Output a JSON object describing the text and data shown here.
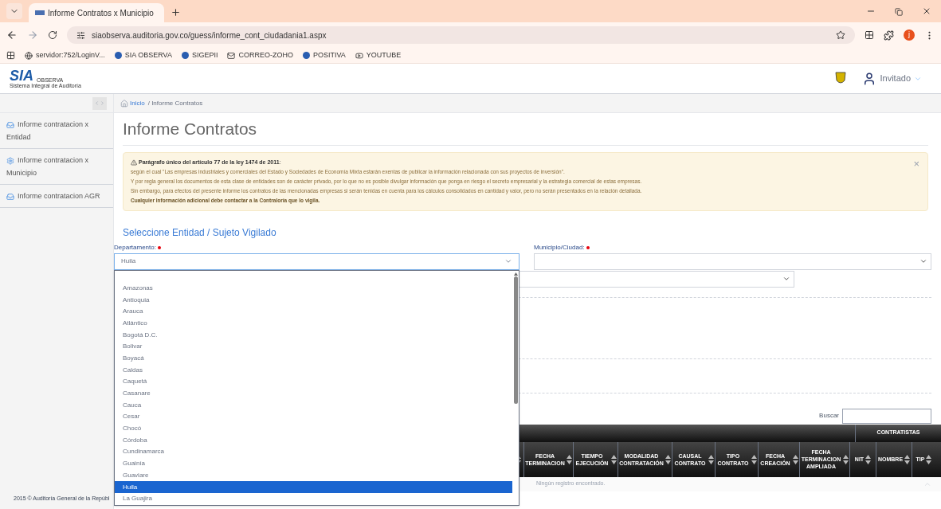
{
  "browser": {
    "tabs": [
      {
        "title": "Informe Contratos x Municipio",
        "selected": true
      }
    ],
    "url": "siaobserva.auditoria.gov.co/guess/informe_cont_ciudadania1.aspx",
    "bookmarks": [
      "servidor:752/LoginV...",
      "SIA OBSERVA",
      "SIGEPII",
      "CORREO-ZOHO",
      "POSITIVA",
      "YOUTUBE"
    ],
    "profile_initial": "j"
  },
  "header": {
    "logo_text": "SIA",
    "logo_sub": "OBSERVA",
    "logo_caption": "Sistema Integral de Auditoría",
    "user": "Invitado"
  },
  "breadcrumb": [
    "Inicio",
    "/ Informe Contratos"
  ],
  "sidebar": {
    "items": [
      {
        "label": "Informe contratacion x Entidad",
        "kind": "inbox"
      },
      {
        "label": "Informe contratacion x Municipio",
        "kind": "gear"
      },
      {
        "label": "Informe contratacion AGR",
        "kind": "inbox"
      }
    ]
  },
  "page_title": "Informe Contratos",
  "alert": {
    "title": "**Parágrafo único del artículo 77 de la ley 1474 de 2011**:",
    "lines": [
      "según el cual \"Las empresas industriales y comerciales del Estado y Sociedades de Economía Mixta estarán exentas de publicar la información relacionada con sus proyectos de inversión\".",
      "Y por regla general los documentos de esta clase de entidades son de carácter privado, por lo que no es posible divulgar información que ponga en riesgo el secreto empresarial y la estrategia comercial de estas empresas.",
      "Sin embargo, para efectos del presente informe los contratos de las mencionadas empresas si serán tenidas en cuenta para los cálculos consolidados en cantidad y valor, pero no serán presentados en la relación detallada."
    ],
    "closing": "Cualquier información adicional debe contactar a la Contraloría que lo vigila.",
    "close": "×"
  },
  "section_title": "Seleccione Entidad / Sujeto Vigilado",
  "departamento": {
    "label": "Departamento:",
    "required": true,
    "value": "Huila",
    "expanded": true,
    "options": [
      {
        "label": "Amazonas",
        "selected": false
      },
      {
        "label": "Antioquia",
        "selected": false
      },
      {
        "label": "Arauca",
        "selected": false
      },
      {
        "label": "Atlántico",
        "selected": false
      },
      {
        "label": "Bogotá D.C.",
        "selected": false
      },
      {
        "label": "Bolivar",
        "selected": false
      },
      {
        "label": "Boyacá",
        "selected": false
      },
      {
        "label": "Caldas",
        "selected": false
      },
      {
        "label": "Caquetá",
        "selected": false
      },
      {
        "label": "Casanare",
        "selected": false
      },
      {
        "label": "Cauca",
        "selected": false
      },
      {
        "label": "Cesar",
        "selected": false
      },
      {
        "label": "Chocó",
        "selected": false
      },
      {
        "label": "Córdoba",
        "selected": false
      },
      {
        "label": "Cundinamarca",
        "selected": false
      },
      {
        "label": "Guainía",
        "selected": false
      },
      {
        "label": "Guaviare",
        "selected": false
      },
      {
        "label": "Huila",
        "selected": true
      },
      {
        "label": "La Guajira",
        "selected": false
      }
    ]
  },
  "municipio": {
    "label": "Municipio/Ciudad:",
    "required": true
  },
  "search": {
    "label": "Buscar"
  },
  "table": {
    "group_header": "CONTRATISTAS",
    "columns": [
      "",
      "FECHA TERMINACION",
      "TIEMPO EJECUCIÓN",
      "MODALIDAD CONTRATACIÓN",
      "CAUSAL CONTRATO",
      "TIPO CONTRATO",
      "FECHA CREACIÓN",
      "FECHA TERMINACION AMPLIADA",
      "NIT",
      "NOMBRE",
      "TIP"
    ],
    "empty_message": "Ningún registro encontrado."
  },
  "footer": "2015 © Auditoría General de la Repúbl"
}
